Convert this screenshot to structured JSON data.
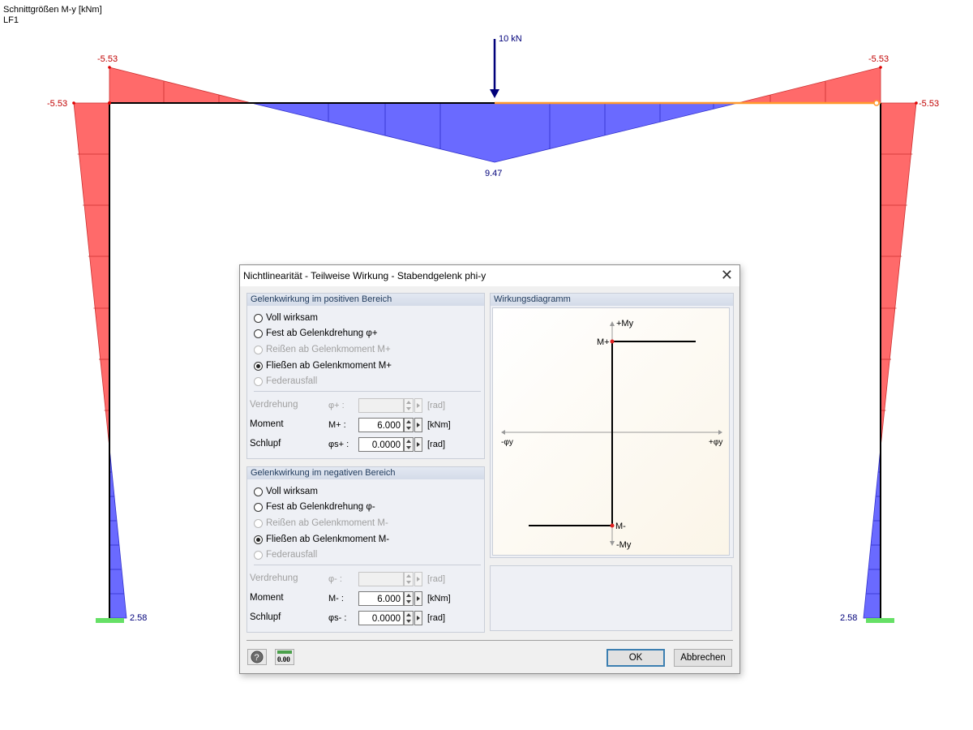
{
  "header": {
    "line1": "Schnittgrößen M-y [kNm]",
    "line2": "LF1"
  },
  "diagram": {
    "load_label": "10 kN",
    "labels": {
      "left_col_top_outer": "-5.53",
      "left_col_top": "-5.53",
      "right_col_top_outer": "-5.53",
      "right_col_top": "-5.53",
      "beam_max": "9.47",
      "left_support": "2.58",
      "right_support": "2.58"
    },
    "colors": {
      "negative": "#ff6a6a",
      "positive": "#6a6aff",
      "member": "#000000",
      "highlight": "#ff9a2e",
      "load": "#00007a",
      "support": "#66e066"
    }
  },
  "dialog": {
    "title": "Nichtlinearität - Teilweise Wirkung - Stabendgelenk phi-y",
    "positive": {
      "heading": "Gelenkwirkung im positiven Bereich",
      "options": [
        {
          "label": "Voll wirksam",
          "selected": false,
          "enabled": true
        },
        {
          "label": "Fest ab Gelenkdrehung φ+",
          "selected": false,
          "enabled": true
        },
        {
          "label": "Reißen ab Gelenkmoment M+",
          "selected": false,
          "enabled": false
        },
        {
          "label": "Fließen ab Gelenkmoment M+",
          "selected": true,
          "enabled": true
        },
        {
          "label": "Federausfall",
          "selected": false,
          "enabled": false
        }
      ],
      "fields": [
        {
          "label": "Verdrehung",
          "symbol": "φ+ :",
          "value": "",
          "unit": "[rad]",
          "enabled": false
        },
        {
          "label": "Moment",
          "symbol": "M+ :",
          "value": "6.000",
          "unit": "[kNm]",
          "enabled": true
        },
        {
          "label": "Schlupf",
          "symbol": "φs+ :",
          "value": "0.0000",
          "unit": "[rad]",
          "enabled": true
        }
      ]
    },
    "negative": {
      "heading": "Gelenkwirkung im negativen Bereich",
      "options": [
        {
          "label": "Voll wirksam",
          "selected": false,
          "enabled": true
        },
        {
          "label": "Fest ab Gelenkdrehung φ-",
          "selected": false,
          "enabled": true
        },
        {
          "label": "Reißen ab Gelenkmoment M-",
          "selected": false,
          "enabled": false
        },
        {
          "label": "Fließen ab Gelenkmoment M-",
          "selected": true,
          "enabled": true
        },
        {
          "label": "Federausfall",
          "selected": false,
          "enabled": false
        }
      ],
      "fields": [
        {
          "label": "Verdrehung",
          "symbol": "φ- :",
          "value": "",
          "unit": "[rad]",
          "enabled": false
        },
        {
          "label": "Moment",
          "symbol": "M- :",
          "value": "6.000",
          "unit": "[kNm]",
          "enabled": true
        },
        {
          "label": "Schlupf",
          "symbol": "φs- :",
          "value": "0.0000",
          "unit": "[rad]",
          "enabled": true
        }
      ]
    },
    "effect_diagram": {
      "heading": "Wirkungsdiagramm",
      "y_pos": "+My",
      "y_neg": "-My",
      "x_neg": "-φy",
      "x_pos": "+φy",
      "m_plus": "M+",
      "m_minus": "M-"
    },
    "buttons": {
      "ok": "OK",
      "cancel": "Abbrechen",
      "help_icon": "question-icon",
      "units_icon": "decimal-places-icon",
      "units_text": "0.00"
    }
  }
}
